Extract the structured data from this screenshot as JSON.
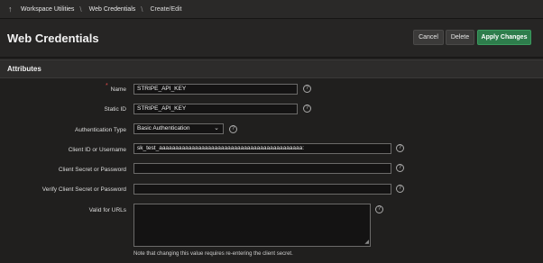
{
  "breadcrumb": {
    "items": [
      "Workspace Utilities",
      "Web Credentials",
      "Create/Edit"
    ]
  },
  "header": {
    "title": "Web Credentials",
    "cancel_label": "Cancel",
    "delete_label": "Delete",
    "apply_label": "Apply Changes"
  },
  "region": {
    "title": "Attributes"
  },
  "form": {
    "name": {
      "label": "Name",
      "value": "STRIPE_API_KEY",
      "required_mark": "*"
    },
    "static_id": {
      "label": "Static ID",
      "value": "STRIPE_API_KEY"
    },
    "auth_type": {
      "label": "Authentication Type",
      "value": "Basic Authentication"
    },
    "client_id": {
      "label": "Client ID or Username",
      "value": "sk_test_aaaaaaaaaaaaaaaaaaaaaaaaaaaaaaaaaaaaaaaaaaaa:"
    },
    "client_secret": {
      "label": "Client Secret or Password",
      "value": ""
    },
    "verify_secret": {
      "label": "Verify Client Secret or Password",
      "value": ""
    },
    "valid_urls": {
      "label": "Valid for URLs",
      "value": ""
    },
    "note": "Note that changing this value requires re-entering the client secret."
  },
  "icons": {
    "up": "arrow-up-icon",
    "help": "help-icon",
    "chevron": "chevron-down-icon"
  },
  "colors": {
    "apply_button": "#2e7d4c",
    "required": "#e24a4a",
    "background": "#201f1e"
  }
}
